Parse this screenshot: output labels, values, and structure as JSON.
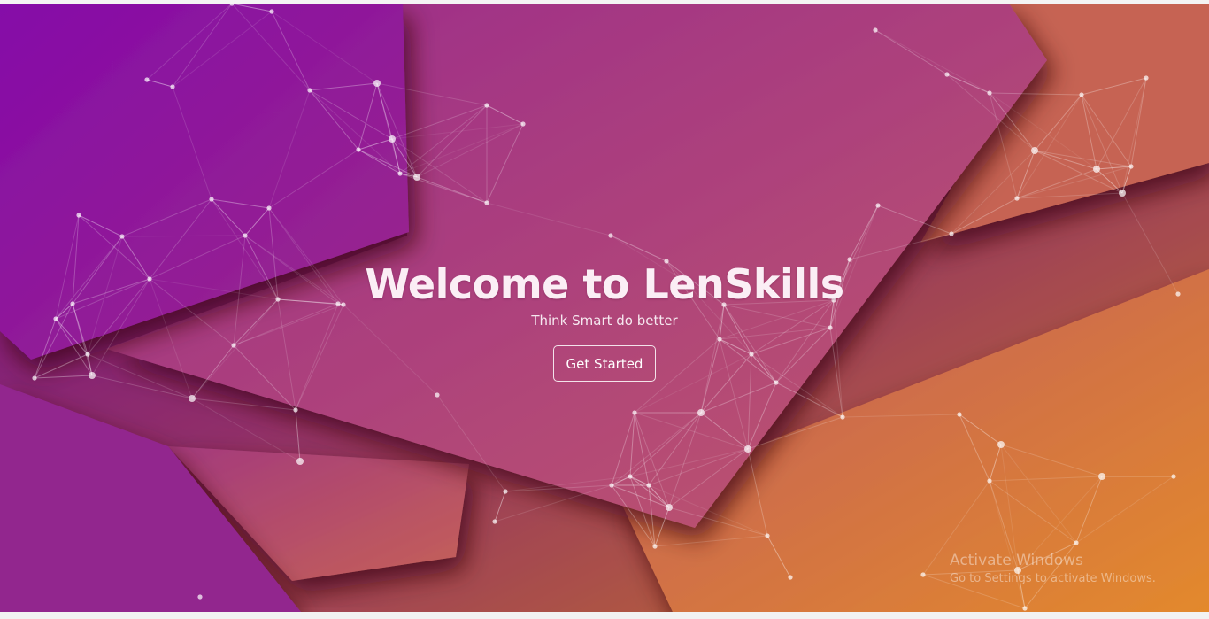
{
  "hero": {
    "title": "Welcome to LenSkills",
    "tagline": "Think Smart do better",
    "cta_label": "Get Started"
  },
  "watermark": {
    "title": "Activate Windows",
    "subtitle": "Go to Settings to activate Windows."
  },
  "colors": {
    "gradient_start": "#7d0aa9",
    "gradient_mid": "#a6397a",
    "gradient_end": "#e48c2a",
    "text": "#ffffff"
  }
}
